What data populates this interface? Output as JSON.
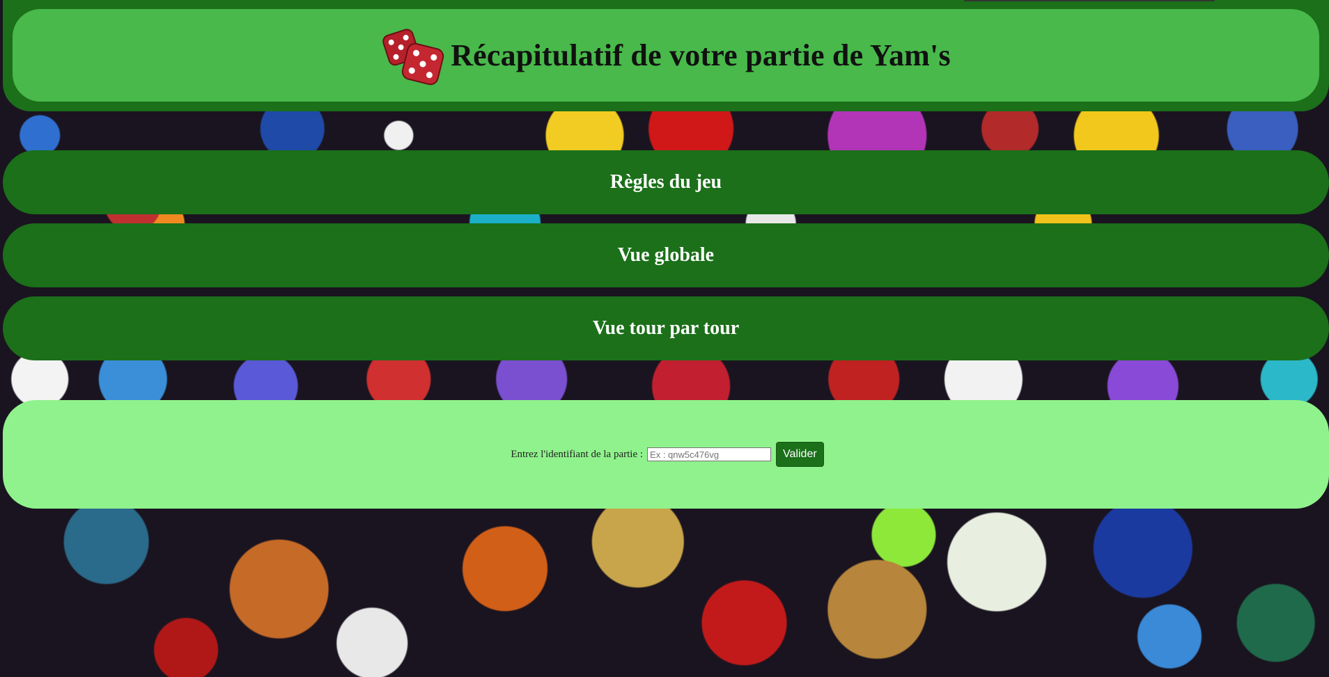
{
  "header": {
    "title": "Récapitulatif de votre partie de Yam's",
    "icon": "dice-icon"
  },
  "nav": {
    "rules_label": "Règles du jeu",
    "global_view_label": "Vue globale",
    "turn_view_label": "Vue tour par tour"
  },
  "form": {
    "label": "Entrez l'identifiant de la partie :",
    "input_placeholder": "Ex : qnw5c476vg",
    "input_value": "",
    "submit_label": "Valider"
  },
  "colors": {
    "dark_green": "#1b7019",
    "header_green": "#48b94a",
    "light_green": "#90f28c"
  }
}
